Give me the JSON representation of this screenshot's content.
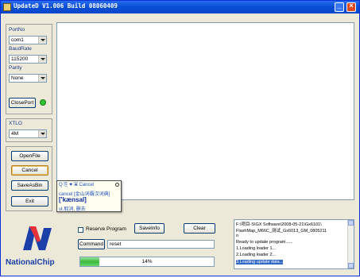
{
  "window": {
    "title": "UpdateD V1.006 Build 08060409",
    "minimize_glyph": "_",
    "close_glyph": "×",
    "title_icon": "app-icon"
  },
  "serial": {
    "port_label": "PortNo",
    "port_value": "com1",
    "baud_label": "BaudRate",
    "baud_value": "115200",
    "parity_label": "Parity",
    "parity_value": "None",
    "close_port_label": "ClosePort",
    "status_color": "#2ec42e"
  },
  "xtlo": {
    "label": "XTLO",
    "value": "4M"
  },
  "buttons": {
    "open_file": "OpenFile",
    "cancel": "Cancel",
    "save_as_bin": "SaveAsBin",
    "exit": "Exit",
    "save_info": "SaveInfo",
    "clear": "Clear",
    "command": "Command"
  },
  "dict_popup": {
    "toolbar": "Q ⎘ ✦ ▣ Cancel",
    "headword_line": "cancel [金山词霸汉词典]",
    "phonetic": "['kænsal]",
    "meaning": "vt.取消, 删去"
  },
  "options": {
    "reserve_program_label": "Reserve Program",
    "reserve_program_checked": false
  },
  "command_input": {
    "value": "reset"
  },
  "progress": {
    "percent_text": "14%",
    "fraction": 0.14,
    "color": "#3cb83c"
  },
  "log": {
    "lines": [
      "F:\\项目-S\\GX Software\\2008-05-21\\Gx6101\\",
      "FlashMap_M66C_测试_Gx6013_GM_0805211",
      "n",
      "Ready to update program......",
      "1.Loading loader 1...",
      "2.Loading loader 2...",
      "3.Loading update data..."
    ],
    "selected_index": 6,
    "selection_color": "#316ac5"
  },
  "brand": {
    "name": "NationalChip",
    "logo_color": "#1a3fa8"
  }
}
